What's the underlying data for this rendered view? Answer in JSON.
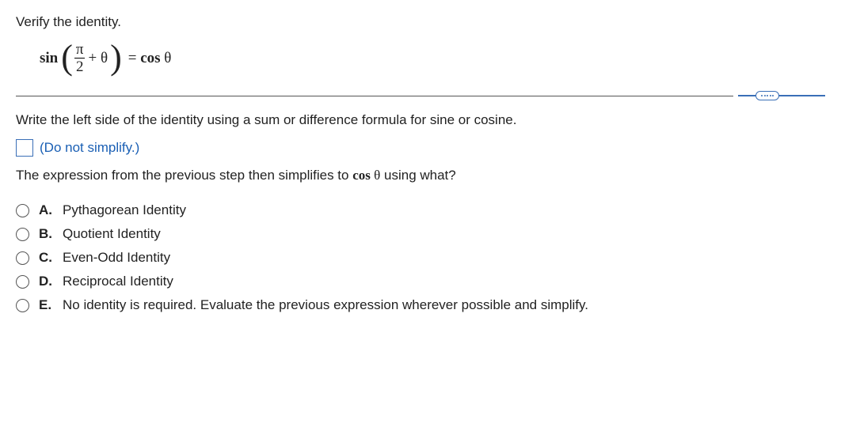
{
  "prompt": "Verify the identity.",
  "equation": {
    "func": "sin",
    "numerator": "π",
    "denominator": "2",
    "plus": "+ θ",
    "equals": "=",
    "rhs_func": "cos",
    "rhs_arg": "θ"
  },
  "step1": "Write the left side of the identity using a sum or difference formula for sine or cosine.",
  "hint": "(Do not simplify.)",
  "step2_pre": "The expression from the previous step then simplifies to ",
  "step2_cos": "cos",
  "step2_theta": " θ",
  "step2_post": " using what?",
  "choices": [
    {
      "label": "A.",
      "text": "Pythagorean Identity"
    },
    {
      "label": "B.",
      "text": "Quotient Identity"
    },
    {
      "label": "C.",
      "text": "Even-Odd Identity"
    },
    {
      "label": "D.",
      "text": "Reciprocal Identity"
    },
    {
      "label": "E.",
      "text": "No identity is required. Evaluate the previous expression wherever possible and simplify."
    }
  ]
}
